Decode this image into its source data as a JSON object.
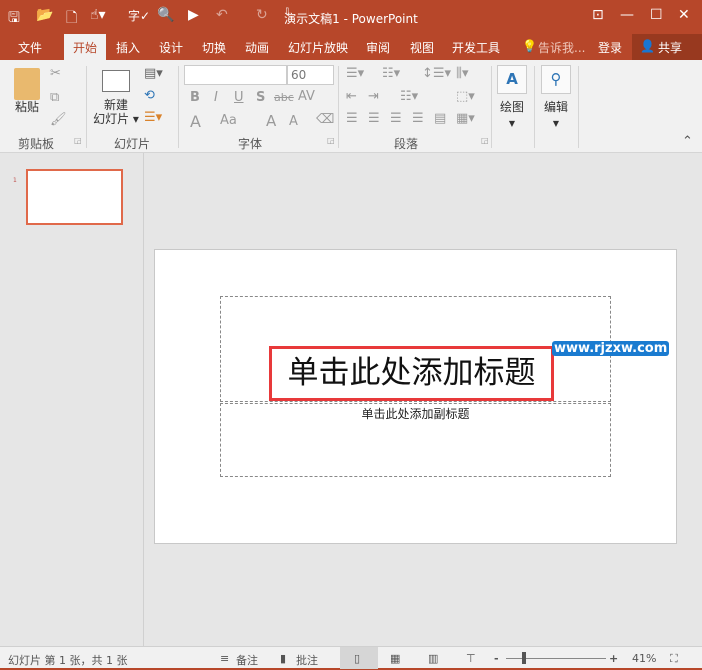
{
  "window": {
    "title": "演示文稿1 - PowerPoint"
  },
  "quick_access": {
    "save": "🖫",
    "open": "📂",
    "new": "🗋",
    "touch": "☝▾",
    "spell": "字✓",
    "preview": "🔍",
    "present": "▶",
    "undo": "↶",
    "redo": "↻",
    "customize": "⇩"
  },
  "window_controls": {
    "ribbon_display": "⊡",
    "minimize": "—",
    "maximize": "☐",
    "close": "✕"
  },
  "tabs": [
    {
      "label": "文件"
    },
    {
      "label": "开始"
    },
    {
      "label": "插入"
    },
    {
      "label": "设计"
    },
    {
      "label": "切换"
    },
    {
      "label": "动画"
    },
    {
      "label": "幻灯片放映"
    },
    {
      "label": "审阅"
    },
    {
      "label": "视图"
    },
    {
      "label": "开发工具"
    }
  ],
  "tell_me": "告诉我...",
  "login": "登录",
  "share": "共享",
  "ribbon": {
    "clipboard": {
      "label": "剪贴板",
      "paste": "粘贴"
    },
    "slides": {
      "label": "幻灯片",
      "new_slide_line1": "新建",
      "new_slide_line2": "幻灯片"
    },
    "font": {
      "label": "字体",
      "font_name": "",
      "font_size": "60",
      "bold": "B",
      "italic": "I",
      "underline": "U",
      "shadow": "S",
      "strike": "abc",
      "spacing": "AV",
      "color": "A",
      "case": "Aa",
      "grow": "A",
      "shrink": "A"
    },
    "paragraph": {
      "label": "段落"
    },
    "drawing": {
      "label": "绘图"
    },
    "editing": {
      "label": "编辑"
    }
  },
  "slide": {
    "title_placeholder": "单击此处添加标题",
    "subtitle_placeholder": "单击此处添加副标题",
    "thumb_number": "1"
  },
  "watermark": "www.rjzxw.com",
  "status": {
    "slide_info": "幻灯片 第 1 张，共 1 张",
    "notes": "备注",
    "comments": "批注",
    "zoom": "41%",
    "zoom_value": 41
  },
  "colors": {
    "accent": "#b7472a",
    "highlight": "#e8393a"
  }
}
